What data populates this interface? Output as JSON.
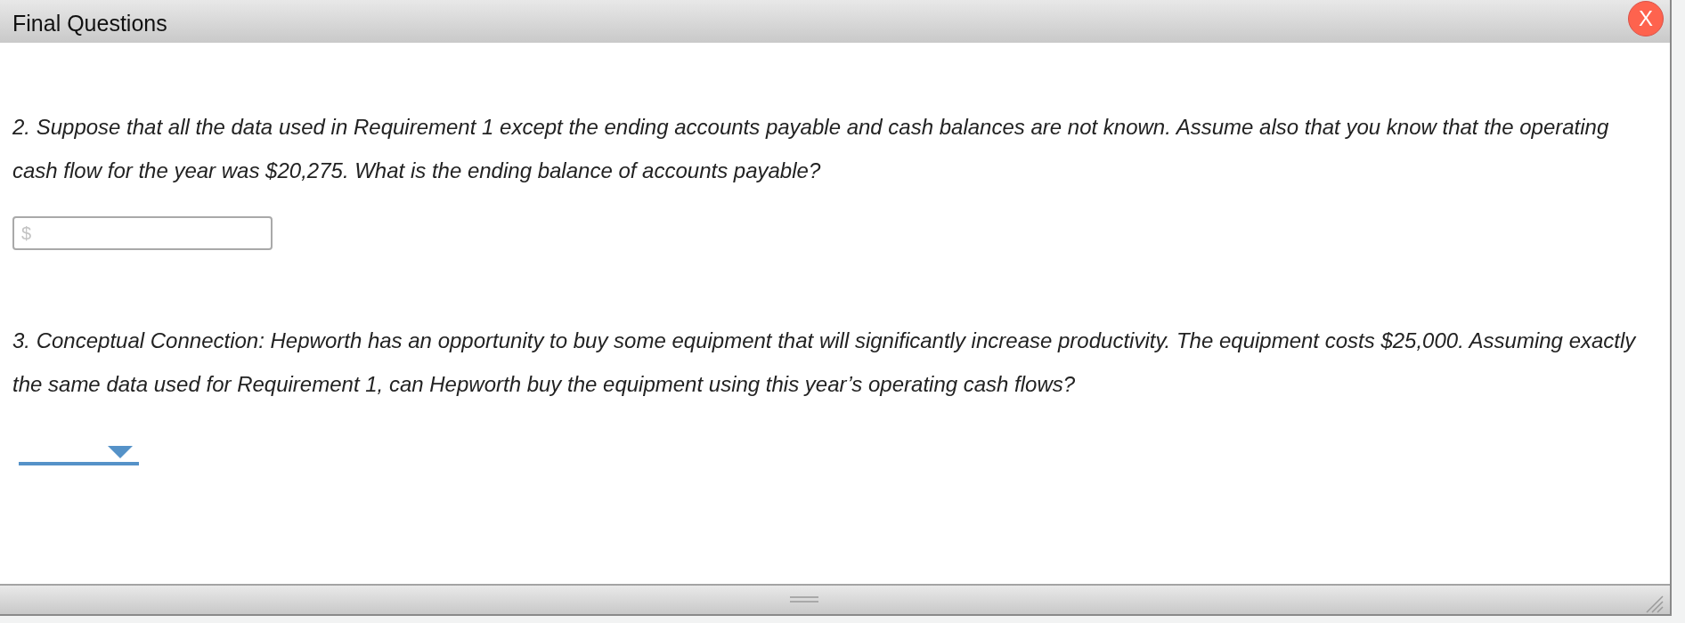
{
  "window": {
    "title": "Final Questions",
    "close_button": {
      "label": "X"
    }
  },
  "questions": [
    {
      "text": "2. Suppose that all the data used in Requirement 1 except the ending accounts payable and cash balances are not known. Assume also that you know that the operating cash flow for the year was $20,275. What is the ending balance of accounts payable?",
      "answer": {
        "kind": "text",
        "placeholder": "$"
      }
    },
    {
      "text": "3. Conceptual Connection: Hepworth has an opportunity to buy some equipment that will significantly increase productivity. The equipment costs $25,000. Assuming exactly the same data used for Requirement 1, can Hepworth buy the equipment using this year’s operating cash flows?",
      "answer": {
        "kind": "dropdown"
      }
    }
  ]
}
